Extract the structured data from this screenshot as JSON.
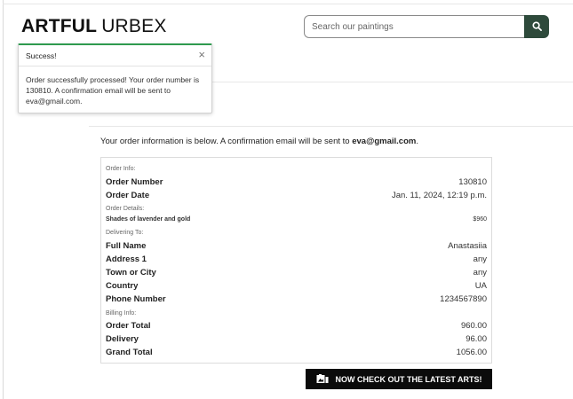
{
  "brand": {
    "part1": "ARTFUL",
    "part2": "URBEX"
  },
  "search": {
    "placeholder": "Search our paintings",
    "icon": "search-icon"
  },
  "toast": {
    "title": "Success!",
    "close_label": "×",
    "message": "Order successfully processed! Your order number is 130810. A confirmation email will be sent to eva@gmail.com."
  },
  "intro": {
    "text": "Your order information is below. A confirmation email will be sent to",
    "email": "eva@gmail.com",
    "end": "."
  },
  "order": {
    "order_info_label": "Order Info:",
    "order_number_label": "Order Number",
    "order_number": "130810",
    "order_date_label": "Order Date",
    "order_date": "Jan. 11, 2024, 12:19 p.m.",
    "order_details_label": "Order Details:",
    "item_name": "Shades of lavender and gold",
    "item_price": "$960",
    "delivering_label": "Delivering To:",
    "full_name_label": "Full Name",
    "full_name": "Anastasiia",
    "address1_label": "Address 1",
    "address1": "any",
    "town_label": "Town or City",
    "town": "any",
    "country_label": "Country",
    "country": "UA",
    "phone_label": "Phone Number",
    "phone": "1234567890",
    "billing_label": "Billing Info:",
    "order_total_label": "Order Total",
    "order_total": "960.00",
    "delivery_label": "Delivery",
    "delivery": "96.00",
    "grand_total_label": "Grand Total",
    "grand_total": "1056.00"
  },
  "cta": {
    "label": "NOW CHECK OUT THE LATEST ARTS!",
    "icon": "gallery-icon"
  },
  "colors": {
    "success": "#2f9a4f",
    "search_button": "#2e4a3b",
    "cta_bg": "#0b0b0b"
  }
}
